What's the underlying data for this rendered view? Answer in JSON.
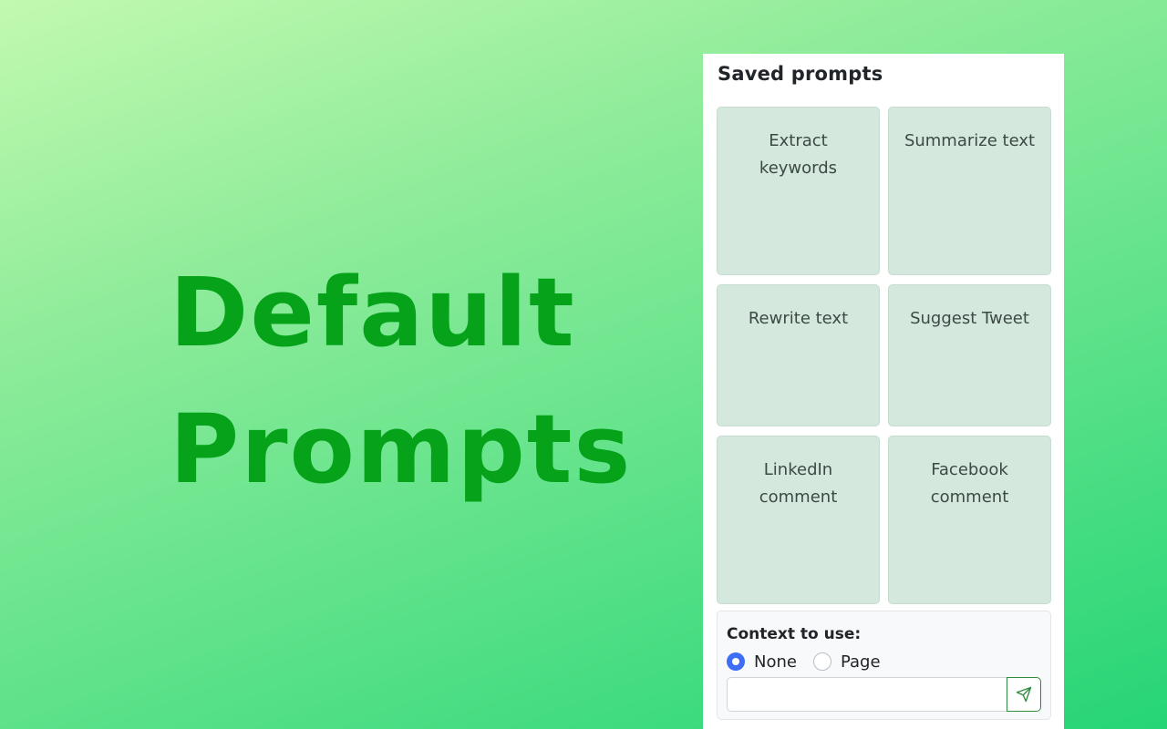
{
  "hero": {
    "line1": "Default",
    "line2": "Prompts",
    "color": "#05a21a"
  },
  "panel": {
    "title": "Saved prompts",
    "prompts": [
      {
        "label": "Extract keywords"
      },
      {
        "label": "Summarize text"
      },
      {
        "label": "Rewrite text"
      },
      {
        "label": "Suggest Tweet"
      },
      {
        "label": "LinkedIn comment"
      },
      {
        "label": "Facebook comment"
      }
    ],
    "card_color": "#d4e8de"
  },
  "context": {
    "label": "Context to use:",
    "options": [
      {
        "label": "None",
        "selected": true
      },
      {
        "label": "Page",
        "selected": false
      }
    ],
    "input_value": "",
    "input_placeholder": "",
    "send_icon": "paper-plane-icon",
    "accent_color": "#3d6ef5"
  }
}
